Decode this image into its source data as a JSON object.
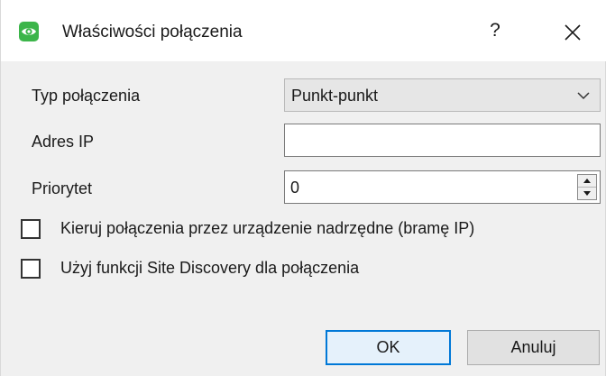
{
  "window": {
    "title": "Właściwości połączenia",
    "help_label": "?",
    "icon": "eye-icon",
    "close_icon": "close-icon",
    "accent_color": "#3cb54a"
  },
  "form": {
    "connection_type_label": "Typ połączenia",
    "connection_type_value": "Punkt-punkt",
    "ip_address_label": "Adres IP",
    "ip_address_value": "",
    "priority_label": "Priorytet",
    "priority_value": "0"
  },
  "options": {
    "route_via_master_label": "Kieruj połączenia przez urządzenie nadrzędne (bramę IP)",
    "route_via_master_checked": false,
    "site_discovery_label": "Użyj funkcji Site Discovery dla połączenia",
    "site_discovery_checked": false
  },
  "buttons": {
    "ok_label": "OK",
    "cancel_label": "Anuluj"
  }
}
